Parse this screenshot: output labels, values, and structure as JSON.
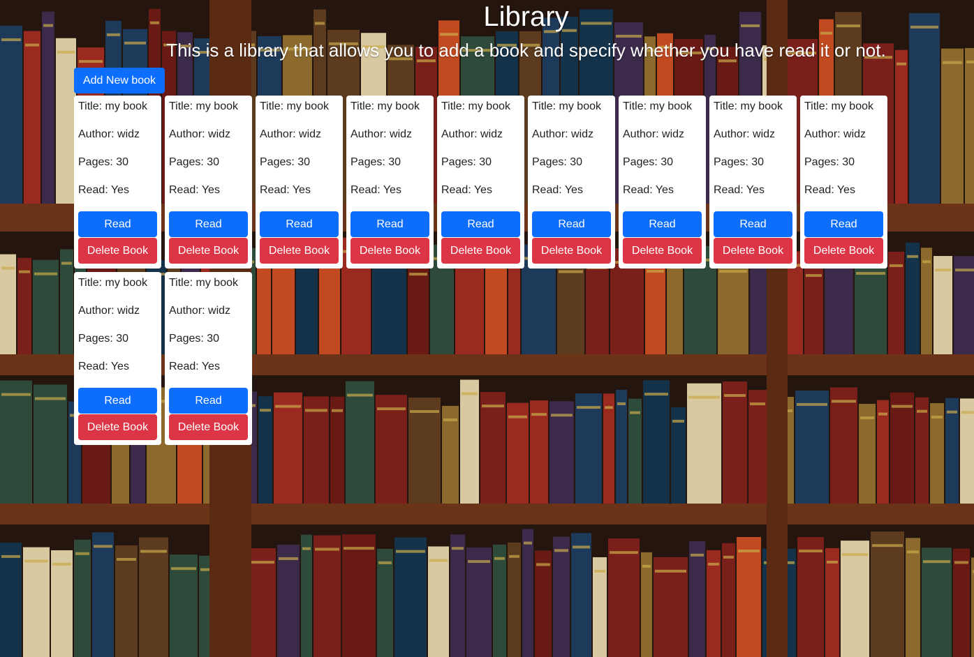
{
  "header": {
    "title": "Library",
    "subtitle": "This is a library that allows you to add a book and specify whether you have read it or not."
  },
  "toolbar": {
    "add_label": "Add New book"
  },
  "colors": {
    "primary": "#0d6efd",
    "danger": "#dc3545"
  },
  "books": [
    {
      "title_line": "Title: my book",
      "author_line": "Author: widz",
      "pages_line": "Pages: 30",
      "read_line": "Read: Yes",
      "read_btn": "Read",
      "delete_btn": "Delete Book"
    },
    {
      "title_line": "Title: my book",
      "author_line": "Author: widz",
      "pages_line": "Pages: 30",
      "read_line": "Read: Yes",
      "read_btn": "Read",
      "delete_btn": "Delete Book"
    },
    {
      "title_line": "Title: my book",
      "author_line": "Author: widz",
      "pages_line": "Pages: 30",
      "read_line": "Read: Yes",
      "read_btn": "Read",
      "delete_btn": "Delete Book"
    },
    {
      "title_line": "Title: my book",
      "author_line": "Author: widz",
      "pages_line": "Pages: 30",
      "read_line": "Read: Yes",
      "read_btn": "Read",
      "delete_btn": "Delete Book"
    },
    {
      "title_line": "Title: my book",
      "author_line": "Author: widz",
      "pages_line": "Pages: 30",
      "read_line": "Read: Yes",
      "read_btn": "Read",
      "delete_btn": "Delete Book"
    },
    {
      "title_line": "Title: my book",
      "author_line": "Author: widz",
      "pages_line": "Pages: 30",
      "read_line": "Read: Yes",
      "read_btn": "Read",
      "delete_btn": "Delete Book"
    },
    {
      "title_line": "Title: my book",
      "author_line": "Author: widz",
      "pages_line": "Pages: 30",
      "read_line": "Read: Yes",
      "read_btn": "Read",
      "delete_btn": "Delete Book"
    },
    {
      "title_line": "Title: my book",
      "author_line": "Author: widz",
      "pages_line": "Pages: 30",
      "read_line": "Read: Yes",
      "read_btn": "Read",
      "delete_btn": "Delete Book"
    },
    {
      "title_line": "Title: my book",
      "author_line": "Author: widz",
      "pages_line": "Pages: 30",
      "read_line": "Read: Yes",
      "read_btn": "Read",
      "delete_btn": "Delete Book"
    },
    {
      "title_line": "Title: my book",
      "author_line": "Author: widz",
      "pages_line": "Pages: 30",
      "read_line": "Read: Yes",
      "read_btn": "Read",
      "delete_btn": "Delete Book"
    },
    {
      "title_line": "Title: my book",
      "author_line": "Author: widz",
      "pages_line": "Pages: 30",
      "read_line": "Read: Yes",
      "read_btn": "Read",
      "delete_btn": "Delete Book"
    }
  ]
}
